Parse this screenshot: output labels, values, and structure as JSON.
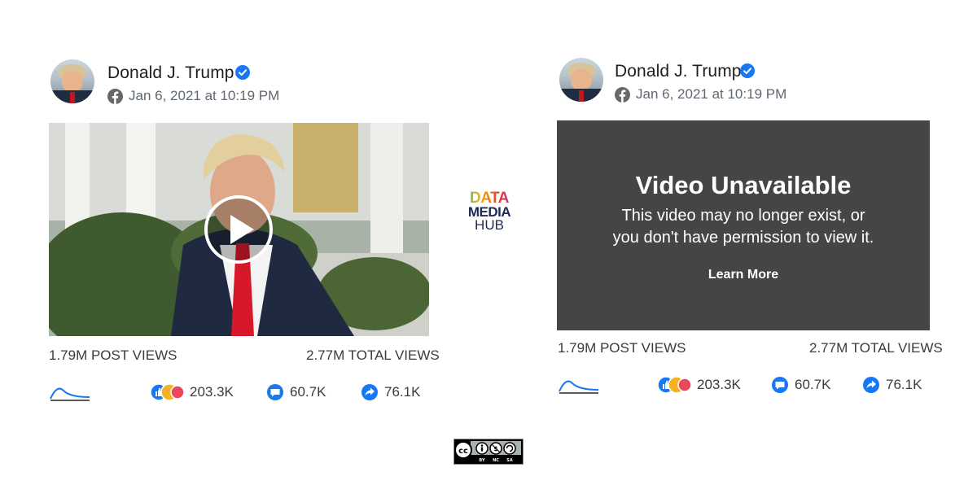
{
  "left_post": {
    "author": "Donald J. Trump",
    "date": "Jan 6, 2021 at 10:19 PM",
    "post_views": "1.79M POST VIEWS",
    "total_views": "2.77M TOTAL VIEWS",
    "reactions": "203.3K",
    "comments": "60.7K",
    "shares": "76.1K"
  },
  "right_post": {
    "author": "Donald J. Trump",
    "date": "Jan 6, 2021 at 10:19 PM",
    "unavailable_title": "Video Unavailable",
    "unavailable_line1": "This video may no longer exist, or",
    "unavailable_line2": "you don't have permission to view it.",
    "learn_more": "Learn More",
    "post_views": "1.79M POST VIEWS",
    "total_views": "2.77M TOTAL VIEWS",
    "reactions": "203.3K",
    "comments": "60.7K",
    "shares": "76.1K"
  },
  "logo": {
    "line1": "DATA",
    "line2": "MEDIA",
    "line3": "HUB"
  },
  "license": {
    "cc": "cc",
    "labels": [
      "BY",
      "NC",
      "SA"
    ]
  },
  "colors": {
    "facebook_blue": "#1877f2",
    "unavailable_bg": "#444546",
    "like_blue": "#1877f2",
    "tie_red": "#d7182a"
  }
}
